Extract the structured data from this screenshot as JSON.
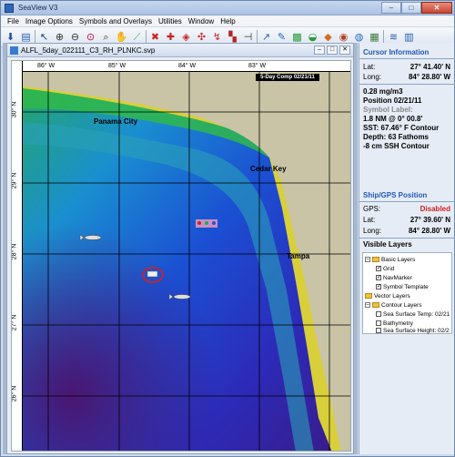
{
  "window": {
    "title": "SeaView V3",
    "minimize": "–",
    "maximize": "□",
    "close": "✕"
  },
  "menu": [
    "File",
    "Image Options",
    "Symbols and Overlays",
    "Utilities",
    "Window",
    "Help"
  ],
  "toolbar_icons": [
    "download-icon",
    "open-folder-icon",
    "pointer-icon",
    "zoom-in-icon",
    "zoom-out-icon",
    "zoom-reset-icon",
    "zoom-region-icon",
    "pan-hand-icon",
    "measure-icon",
    "ruler-icon",
    "mark-icon",
    "crosshair-icon",
    "compass-icon",
    "route-icon",
    "bathymetry-icon",
    "contour-icon",
    "layers-icon",
    "globe-icon",
    "image-icon",
    "palette-icon",
    "grid-icon",
    "tide-icon",
    "export-icon"
  ],
  "document": {
    "title": "ALFL_5day_022111_C3_RH_PLNKC.svp",
    "date_banner": "5-Day Comp 02/21/11"
  },
  "map": {
    "lon_ticks": [
      "86° W",
      "85° W",
      "84° W",
      "83° W"
    ],
    "lat_ticks": [
      "30° N",
      "29° N",
      "28° N",
      "27° N",
      "26° N"
    ],
    "places": {
      "panama_city": "Panama City",
      "cedar_key": "Cedar Key",
      "tampa": "Tampa"
    }
  },
  "cursor_info": {
    "title": "Cursor Information",
    "lat_label": "Lat:",
    "lat_value": "27° 41.40' N",
    "long_label": "Long:",
    "long_value": "84° 28.80' W",
    "value_line": "0.28 mg/m3",
    "position_line": "Position 02/21/11",
    "symbol_label": "Symbol Label:",
    "nm_line": "1.8 NM @ 0° 00.8'",
    "sst_line": "SST: 67.46° F Contour",
    "depth_line": "Depth: 63 Fathoms",
    "ssh_line": "-8 cm SSH Contour"
  },
  "ship_gps": {
    "title": "Ship/GPS Position",
    "gps_label": "GPS:",
    "gps_status": "Disabled",
    "lat_label": "Lat:",
    "lat_value": "27° 39.60' N",
    "long_label": "Long:",
    "long_value": "84° 28.80' W"
  },
  "visible_layers": {
    "title": "Visible Layers",
    "groups": [
      {
        "name": "Basic Layers",
        "items": [
          {
            "name": "Grid",
            "checked": true
          },
          {
            "name": "NavMarker",
            "checked": true
          },
          {
            "name": "Symbol Template",
            "checked": true
          }
        ]
      },
      {
        "name": "Vector Layers",
        "items": []
      },
      {
        "name": "Contour Layers",
        "items": [
          {
            "name": "Sea Surface Temp: 02/21",
            "checked": false
          },
          {
            "name": "Bathymetry",
            "checked": false
          },
          {
            "name": "Sea Surface Height: 02/2",
            "checked": false
          }
        ]
      }
    ]
  }
}
